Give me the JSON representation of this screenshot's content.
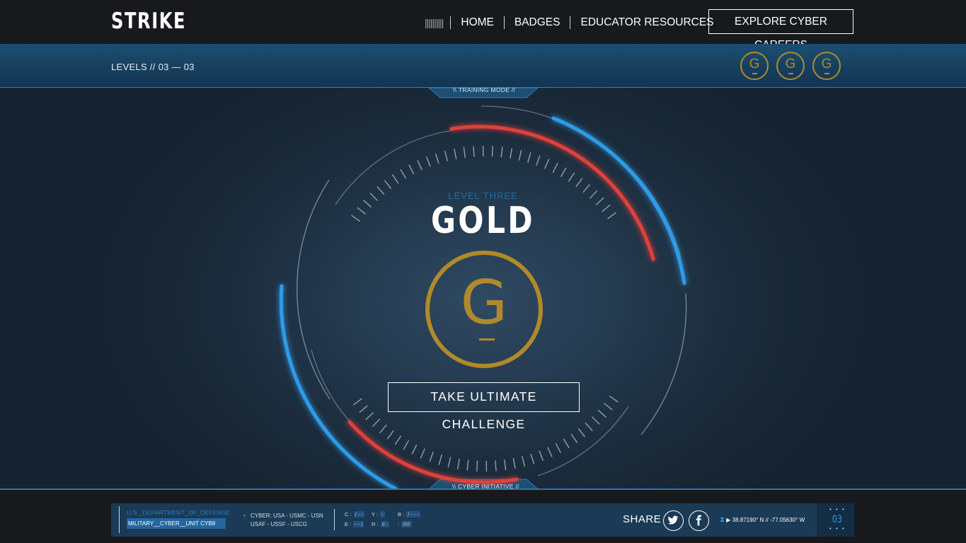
{
  "header": {
    "logo": "STRIKE",
    "nav_bars": "||||||||||",
    "nav": [
      "HOME",
      "BADGES",
      "EDUCATOR RESOURCES"
    ],
    "cta": "EXPLORE CYBER CAREERS"
  },
  "subbar": {
    "levels": "LEVELS // 03 — 03",
    "badge_letter": "G"
  },
  "main": {
    "top_tab": "\\\\ TRAINING MODE //",
    "bottom_tab": "\\\\ CYBER INITIATIVE //",
    "level_sub": "LEVEL THREE",
    "level_title": "GOLD",
    "badge_letter": "G",
    "challenge": "TAKE ULTIMATE CHALLENGE"
  },
  "footer": {
    "dept_line1": "U.S._DEPARTMENT_OF_DEFENSE",
    "dept_line2": "MILITARY__CYBER__UNIT CYB8",
    "branches_line1": "CYBER: USA - USMC - USN",
    "branches_line2": "USAF - USSF - USCG",
    "codes": [
      {
        "k": "C :",
        "v": "/ - -"
      },
      {
        "k": "Y :",
        "v": "-"
      },
      {
        "k": "B :",
        "v": "/ - - -"
      },
      {
        "k": "E :",
        "v": "- - /"
      },
      {
        "k": "R :",
        "v": "// -"
      },
      {
        "k": ":",
        "v": "/////"
      }
    ],
    "share": "SHARE",
    "coords": "38.87190° N // -77.05630° W",
    "level_num": "03",
    "dots": "• • •"
  },
  "colors": {
    "gold": "#b08a2a",
    "blue_arc": "#2f9be8",
    "red_arc": "#e0403a",
    "subbar": "#1b4f73"
  }
}
